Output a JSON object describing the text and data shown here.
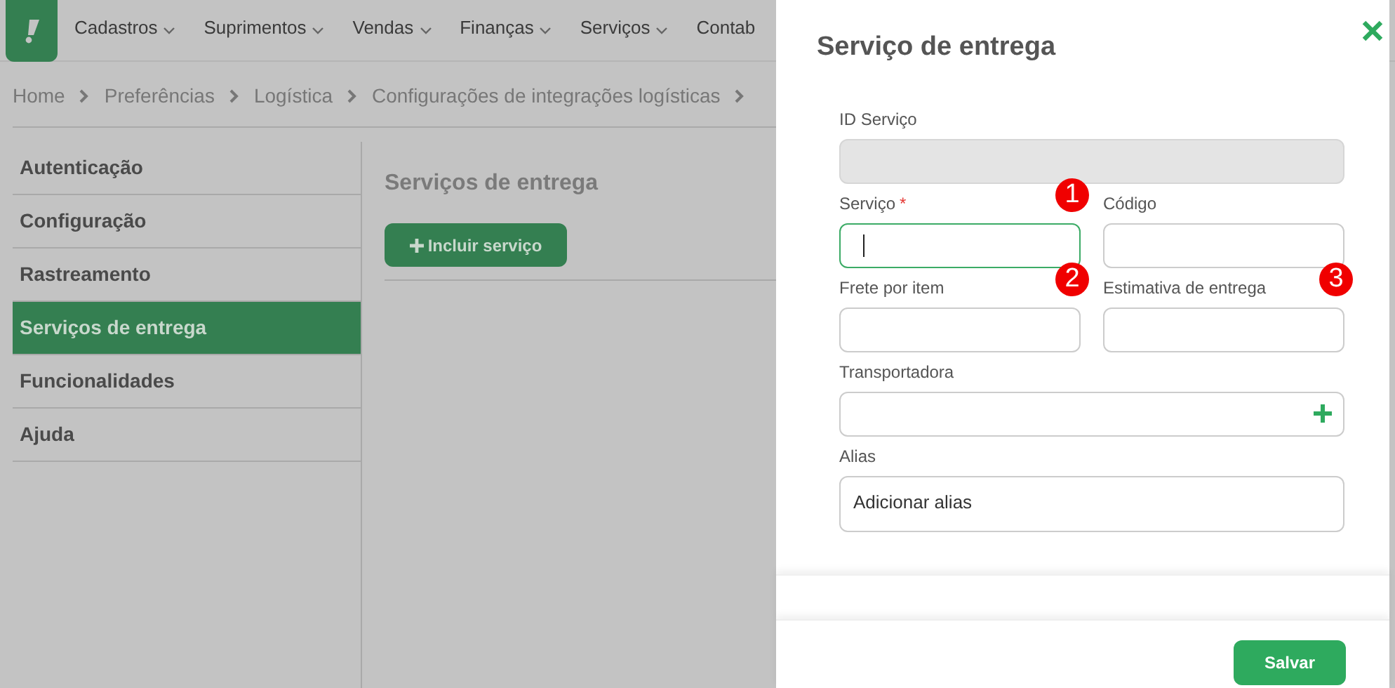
{
  "nav": {
    "menu": [
      {
        "label": "Cadastros",
        "dropdown": true
      },
      {
        "label": "Suprimentos",
        "dropdown": true
      },
      {
        "label": "Vendas",
        "dropdown": true
      },
      {
        "label": "Finanças",
        "dropdown": true
      },
      {
        "label": "Serviços",
        "dropdown": true
      },
      {
        "label": "Contab",
        "dropdown": false
      }
    ]
  },
  "breadcrumb": [
    "Home",
    "Preferências",
    "Logística",
    "Configurações de integrações logísticas"
  ],
  "sidebar": {
    "items": [
      {
        "label": "Autenticação",
        "selected": false
      },
      {
        "label": "Configuração",
        "selected": false
      },
      {
        "label": "Rastreamento",
        "selected": false
      },
      {
        "label": "Serviços de entrega",
        "selected": true
      },
      {
        "label": "Funcionalidades",
        "selected": false
      },
      {
        "label": "Ajuda",
        "selected": false
      }
    ]
  },
  "content": {
    "title": "Serviços de entrega",
    "add_button": "Incluir serviço"
  },
  "drawer": {
    "title": "Serviço de entrega",
    "rows": [
      [
        {
          "label": "ID Serviço",
          "kind": "text",
          "disabled": true,
          "focused": false
        }
      ],
      [
        {
          "label": "Serviço",
          "kind": "text",
          "disabled": false,
          "focused": true,
          "required_mark": "*",
          "annotation": "1"
        },
        {
          "label": "Código",
          "kind": "text",
          "disabled": false,
          "focused": false
        }
      ],
      [
        {
          "label": "Frete por item",
          "kind": "text",
          "disabled": false,
          "focused": false,
          "annotation": "2"
        },
        {
          "label": "Estimativa de entrega",
          "kind": "text",
          "disabled": false,
          "focused": false,
          "annotation": "3"
        }
      ],
      [
        {
          "label": "Transportadora",
          "kind": "lookup"
        }
      ],
      [
        {
          "label": "Alias",
          "kind": "textarea",
          "value": "Adicionar alias"
        }
      ]
    ],
    "save_button": "Salvar"
  }
}
